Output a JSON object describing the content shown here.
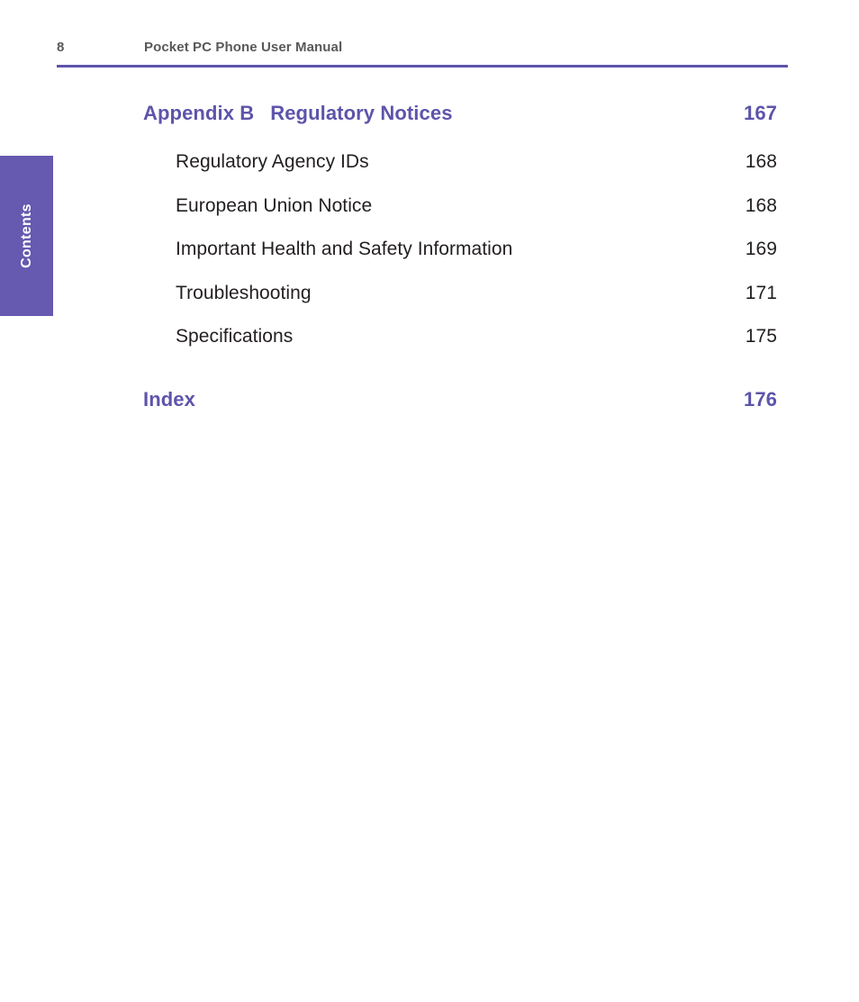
{
  "header": {
    "folio": "8",
    "title": "Pocket PC Phone User Manual"
  },
  "side_tab": {
    "label": "Contents"
  },
  "colors": {
    "accent_purple": "#5d54aa",
    "tab_purple": "#6559b0",
    "header_gray": "#58595b",
    "body_black": "#231f20"
  },
  "toc": {
    "rows": [
      {
        "level": "chapter",
        "number": "Appendix B",
        "title": "Regulatory Notices",
        "page": "167"
      },
      {
        "level": "section",
        "title": "Regulatory Agency IDs",
        "page": "168"
      },
      {
        "level": "section",
        "title": "European Union Notice",
        "page": "168"
      },
      {
        "level": "section",
        "title": "Important Health and Safety Information",
        "page": "169"
      },
      {
        "level": "section",
        "title": "Troubleshooting",
        "page": "171"
      },
      {
        "level": "section",
        "title": "Specifications",
        "page": "175"
      },
      {
        "level": "chapter",
        "number": "",
        "title": "Index",
        "page": "176"
      }
    ]
  }
}
